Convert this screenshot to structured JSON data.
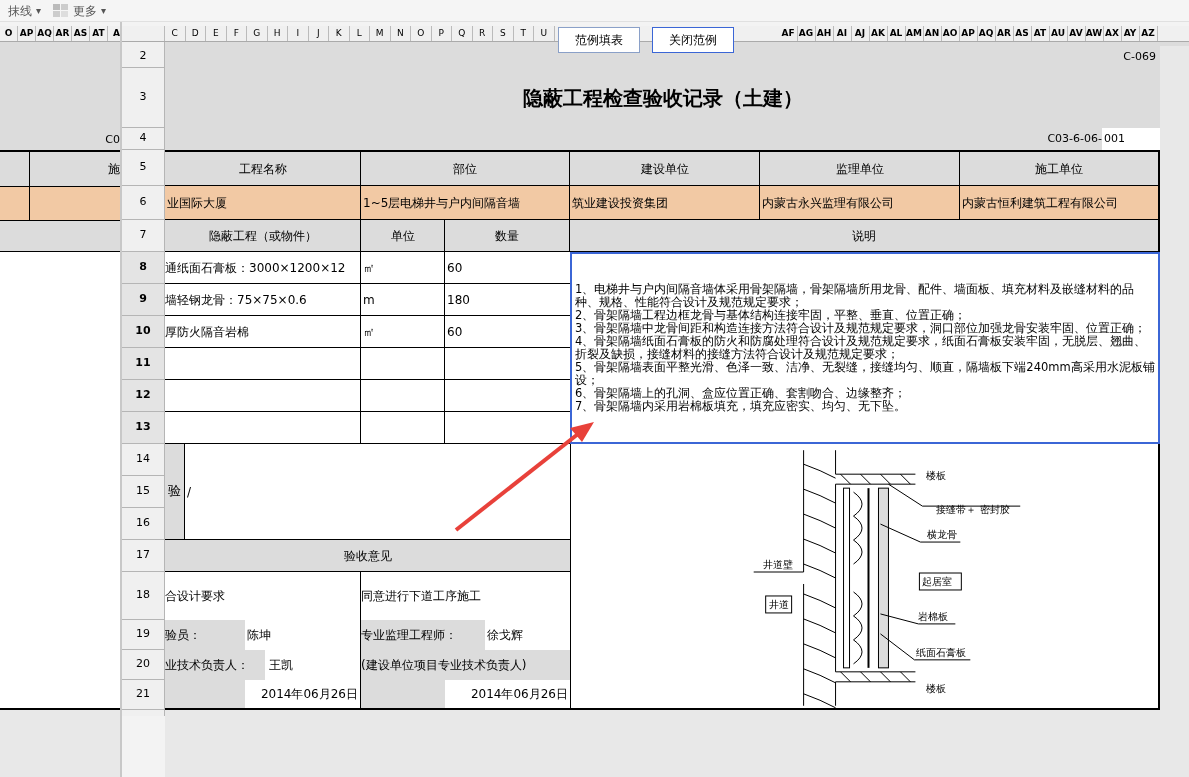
{
  "toolbar": [
    {
      "label": "抹线",
      "kind": "plain",
      "caret": "▾"
    },
    {
      "label": "更多",
      "kind": "grid",
      "caret": "▾"
    }
  ],
  "left_pane": {
    "column_headers": [
      "O",
      "AP",
      "AQ",
      "AR",
      "AS",
      "AT",
      "A"
    ],
    "code_fragment": "C0",
    "header_fragment": "施"
  },
  "column_headers_left": [
    "C",
    "D",
    "E",
    "F",
    "G",
    "H",
    "I",
    "J",
    "K",
    "L",
    "M",
    "N",
    "O",
    "P",
    "Q",
    "R",
    "S",
    "T",
    "U"
  ],
  "column_headers_right": [
    "AF",
    "AG",
    "AH",
    "AI",
    "AJ",
    "AK",
    "AL",
    "AM",
    "AN",
    "AO",
    "AP",
    "AQ",
    "AR",
    "AS",
    "AT",
    "AU",
    "AV",
    "AW",
    "AX",
    "AY",
    "AZ"
  ],
  "buttons": [
    {
      "label": "范例填表",
      "selected": false
    },
    {
      "label": "关闭范例",
      "selected": true
    }
  ],
  "row_headers": [
    {
      "label": "2",
      "selected": false
    },
    {
      "label": "3",
      "selected": false
    },
    {
      "label": "4",
      "selected": false
    },
    {
      "label": "5",
      "selected": false
    },
    {
      "label": "6",
      "selected": false
    },
    {
      "label": "7",
      "selected": false
    },
    {
      "label": "8",
      "selected": true
    },
    {
      "label": "9",
      "selected": true
    },
    {
      "label": "10",
      "selected": true
    },
    {
      "label": "11",
      "selected": true
    },
    {
      "label": "12",
      "selected": true
    },
    {
      "label": "13",
      "selected": true
    },
    {
      "label": "14",
      "selected": false
    },
    {
      "label": "15",
      "selected": false
    },
    {
      "label": "16",
      "selected": false
    },
    {
      "label": "17",
      "selected": false
    },
    {
      "label": "18",
      "selected": false
    },
    {
      "label": "19",
      "selected": false
    },
    {
      "label": "20",
      "selected": false
    },
    {
      "label": "21",
      "selected": false
    }
  ],
  "sheet": {
    "form_code": "C-069",
    "title": "隐蔽工程检查验收记录（土建）",
    "doc_no_prefix": "C03-6-06-",
    "doc_no": "001",
    "info_headers": [
      "工程名称",
      "部位",
      "建设单位",
      "监理单位",
      "施工单位"
    ],
    "info_values": [
      "业国际大厦",
      "1~5层电梯井与户内间隔音墙",
      "筑业建设投资集团",
      "内蒙古永兴监理有限公司",
      "内蒙古恒利建筑工程有限公司"
    ],
    "item_headers": [
      "隐蔽工程（或物件）",
      "单位",
      "数量"
    ],
    "description_header": "说明",
    "items": [
      {
        "name": "通纸面石膏板：3000×1200×12",
        "unit": "㎡",
        "quantity": "60"
      },
      {
        "name": "墙轻钢龙骨：75×75×0.6",
        "unit": "m",
        "quantity": "180"
      },
      {
        "name": "厚防火隔音岩棉",
        "unit": "㎡",
        "quantity": "60"
      }
    ],
    "description": [
      "1、电梯井与户内间隔音墙体采用骨架隔墙，骨架隔墙所用龙骨、配件、墙面板、填充材料及嵌缝材料的品种、规格、性能符合设计及规范规定要求；",
      "2、骨架隔墙工程边框龙骨与基体结构连接牢固，平整、垂直、位置正确；",
      "3、骨架隔墙中龙骨间距和构造连接方法符合设计及规范规定要求，洞口部位加强龙骨安装牢固、位置正确；",
      "4、骨架隔墙纸面石膏板的防火和防腐处理符合设计及规范规定要求，纸面石膏板安装牢固，无脱层、翘曲、折裂及缺损，接缝材料的接缝方法符合设计及规范规定要求；",
      "5、骨架隔墙表面平整光滑、色泽一致、洁净、无裂缝，接缝均匀、顺直，隔墙板下端240mm高采用水泥板铺设；",
      "6、骨架隔墙上的孔洞、盒应位置正确、套割吻合、边缘整齐；",
      "7、骨架隔墙内采用岩棉板填充，填充应密实、均匀、无下坠。"
    ],
    "remarks_label": "验",
    "remarks": "/",
    "opinion_header": "验收意见",
    "opinions": [
      "合设计要求",
      "同意进行下道工序施工"
    ],
    "signatures_left": [
      {
        "label": "验员：",
        "name": "陈坤"
      },
      {
        "label": "业技术负责人：",
        "name": "王凯"
      }
    ],
    "signatures_right": [
      {
        "label": "专业监理工程师：",
        "name": "徐戈辉"
      },
      {
        "label": "(建设单位项目专业技术负责人)"
      }
    ],
    "dates": [
      "2014年06月26日",
      "2014年06月26日"
    ],
    "drawing_labels": [
      "楼板",
      "接缝带＋ 密封胶",
      "横龙骨",
      "井道壁",
      "起居室",
      "井道",
      "岩棉板",
      "纸面石膏板",
      "楼板"
    ]
  }
}
